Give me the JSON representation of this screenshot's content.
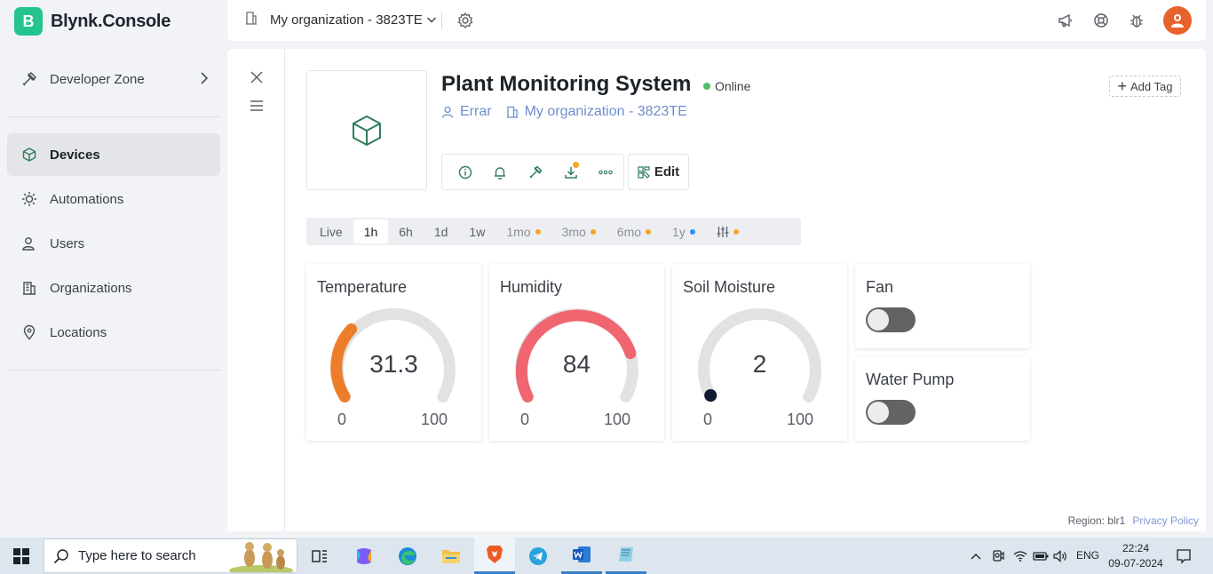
{
  "app": {
    "logo_letter": "B",
    "name": "Blynk.Console",
    "brand_color": "#23c48e"
  },
  "sidebar": {
    "developer_zone": "Developer Zone",
    "items": [
      {
        "label": "Devices",
        "icon": "cube-icon",
        "active": true
      },
      {
        "label": "Automations",
        "icon": "sun-icon"
      },
      {
        "label": "Users",
        "icon": "users-icon"
      },
      {
        "label": "Organizations",
        "icon": "building-icon"
      },
      {
        "label": "Locations",
        "icon": "location-pin-icon"
      }
    ]
  },
  "topbar": {
    "org": "My organization - 3823TE",
    "icons": [
      "megaphone-icon",
      "lifebuoy-icon",
      "bug-icon",
      "avatar"
    ]
  },
  "device": {
    "name": "Plant Monitoring System",
    "status": "Online",
    "status_color": "#4ec16a",
    "owner": "Errar",
    "organization": "My organization - 3823TE",
    "add_tag": "Add Tag",
    "edit": "Edit",
    "actions": [
      "info-icon",
      "bell-icon",
      "tools-icon",
      "download-icon",
      "more-icon"
    ]
  },
  "timerange": {
    "options": [
      {
        "label": "Live"
      },
      {
        "label": "1h",
        "active": true
      },
      {
        "label": "6h"
      },
      {
        "label": "1d"
      },
      {
        "label": "1w"
      },
      {
        "label": "1mo",
        "dot": "#f5a623"
      },
      {
        "label": "3mo",
        "dot": "#f5a623"
      },
      {
        "label": "6mo",
        "dot": "#f5a623"
      },
      {
        "label": "1y",
        "dot": "#2d8cf0"
      }
    ],
    "settings_dot": "#f5a623"
  },
  "widgets": {
    "temperature": {
      "title": "Temperature",
      "value": "31.3",
      "min": "0",
      "max": "100",
      "color": "#ed7d2a"
    },
    "humidity": {
      "title": "Humidity",
      "value": "84",
      "min": "0",
      "max": "100",
      "color": "#f0656f"
    },
    "soil": {
      "title": "Soil Moisture",
      "value": "2",
      "min": "0",
      "max": "100",
      "color": "#0f1a33"
    },
    "fan": {
      "title": "Fan",
      "on": false
    },
    "pump": {
      "title": "Water Pump",
      "on": false
    }
  },
  "footer": {
    "region": "Region: blr1",
    "privacy": "Privacy Policy"
  },
  "taskbar": {
    "search_placeholder": "Type here to search",
    "apps": [
      "task-view-icon",
      "copilot-icon",
      "edge-icon",
      "file-explorer-icon",
      "brave-icon",
      "telegram-icon",
      "word-icon",
      "notepad-icon"
    ],
    "language": "ENG",
    "time": "22:24",
    "date": "09-07-2024"
  }
}
